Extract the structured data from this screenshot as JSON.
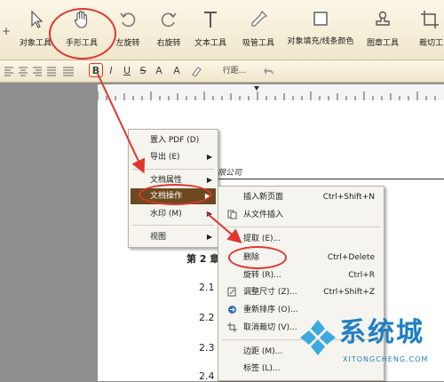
{
  "toolbar": {
    "items": [
      {
        "label": "对象工具",
        "icon": "cursor-icon"
      },
      {
        "label": "手形工具",
        "icon": "hand-icon"
      },
      {
        "label": "左旋转",
        "icon": "rotate-left-icon"
      },
      {
        "label": "右旋转",
        "icon": "rotate-right-icon"
      },
      {
        "label": "文本工具",
        "icon": "text-tool-icon"
      },
      {
        "label": "吸管工具",
        "icon": "eyedropper-icon"
      },
      {
        "label": "对象填充/线条颜色",
        "icon": "fill-color-icon"
      },
      {
        "label": "图章工具",
        "icon": "stamp-icon"
      },
      {
        "label": "裁切工",
        "icon": "crop-icon"
      }
    ]
  },
  "format": {
    "bold": "B",
    "italic": "I",
    "underline": "U",
    "strike": "S",
    "sup": "A",
    "sub": "A",
    "spacing": "行距..."
  },
  "document": {
    "company": "有限公司",
    "chapter": "第 2 章",
    "lines": [
      "2.1",
      "2.2",
      "2.3",
      "2.4"
    ]
  },
  "context_menu": {
    "items": [
      {
        "label": "置入 PDF (D)"
      },
      {
        "label": "导出 (E)",
        "submenu": true
      },
      {
        "label": "文档属性",
        "submenu": true
      },
      {
        "label": "文档操作",
        "submenu": true,
        "active": true
      },
      {
        "label": "水印 (M)",
        "submenu": true
      },
      {
        "label": "视图",
        "submenu": true
      }
    ]
  },
  "submenu": {
    "items": [
      {
        "label": "插入新页面",
        "shortcut": "Ctrl+Shift+N"
      },
      {
        "label": "从文件插入",
        "shortcut": ""
      },
      {
        "label": "提取 (E)...",
        "shortcut": ""
      },
      {
        "label": "删除",
        "shortcut": "Ctrl+Delete"
      },
      {
        "label": "旋转 (R)...",
        "shortcut": "Ctrl+R"
      },
      {
        "label": "调整尺寸 (Z)...",
        "shortcut": "Ctrl+Shift+Z"
      },
      {
        "label": "重新排序 (O)...",
        "shortcut": ""
      },
      {
        "label": "取消裁切 (V)...",
        "shortcut": ""
      },
      {
        "label": "边距 (M)...",
        "shortcut": ""
      },
      {
        "label": "标签 (L)...",
        "shortcut": ""
      }
    ]
  },
  "watermark": {
    "brand": "系统城",
    "url": "XITONGCHENG.COM"
  },
  "colors": {
    "annotation": "#e0362e",
    "menu_active": "#6b4a1f",
    "toolbar": "#f3ebd3"
  }
}
